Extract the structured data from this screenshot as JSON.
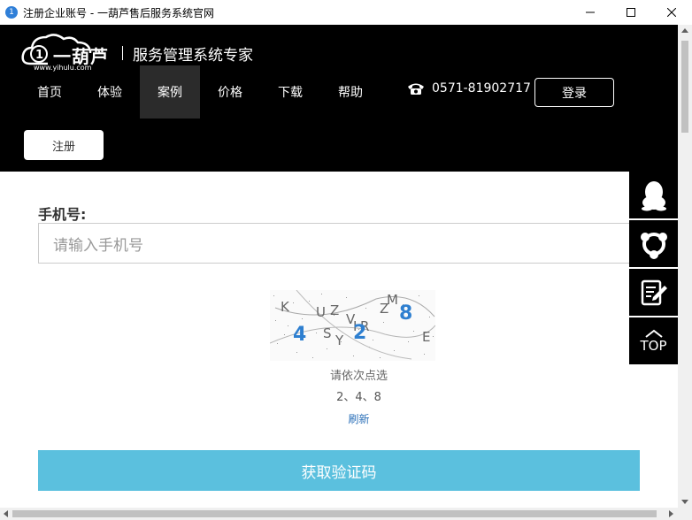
{
  "window": {
    "title": "注册企业账号 - 一葫芦售后服务系统官网",
    "app_icon_glyph": "1"
  },
  "header": {
    "logo_text": "一葫芦",
    "logo_url": "www.yihulu.com",
    "slogan": "服务管理系统专家",
    "nav": [
      {
        "label": "首页",
        "active": false
      },
      {
        "label": "体验",
        "active": false
      },
      {
        "label": "案例",
        "active": true
      },
      {
        "label": "价格",
        "active": false
      },
      {
        "label": "下载",
        "active": false
      },
      {
        "label": "帮助",
        "active": false
      }
    ],
    "phone": "0571-81902717",
    "login_label": "登录",
    "register_label": "注册"
  },
  "form": {
    "phone_label": "手机号:",
    "phone_placeholder": "请输入手机号",
    "captcha_hint": "请依次点选",
    "captcha_sequence": "2、4、8",
    "refresh_label": "刷新",
    "get_code_label": "获取验证码"
  },
  "captcha_chars": {
    "gray": [
      "K",
      "U",
      "Z",
      "V",
      "M",
      "Z",
      "I",
      "R",
      "S",
      "Y",
      "E"
    ],
    "blue": [
      "4",
      "2",
      "8"
    ]
  },
  "float_bar": {
    "top_label": "TOP"
  },
  "colors": {
    "header_bg": "#000000",
    "button_accent": "#5bc0de",
    "captcha_digit": "#2e7fd0",
    "link": "#2a6fb8"
  }
}
